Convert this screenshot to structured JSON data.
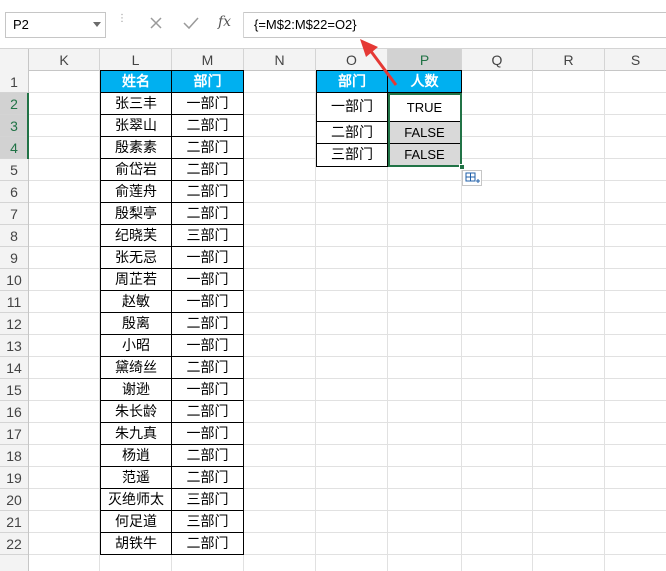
{
  "name_box": {
    "value": "P2"
  },
  "formula_bar": {
    "fx_label": "fx",
    "formula": "{=M$2:M$22=O2}"
  },
  "columns": [
    "K",
    "L",
    "M",
    "N",
    "O",
    "P",
    "Q",
    "R",
    "S"
  ],
  "rows": [
    "1",
    "2",
    "3",
    "4",
    "5",
    "6",
    "7",
    "8",
    "9",
    "10",
    "11",
    "12",
    "13",
    "14",
    "15",
    "16",
    "17",
    "18",
    "19",
    "20",
    "21",
    "22"
  ],
  "table_left": {
    "headers": [
      "姓名",
      "部门"
    ],
    "rows": [
      [
        "张三丰",
        "一部门"
      ],
      [
        "张翠山",
        "二部门"
      ],
      [
        "殷素素",
        "二部门"
      ],
      [
        "俞岱岩",
        "二部门"
      ],
      [
        "俞莲舟",
        "二部门"
      ],
      [
        "殷梨亭",
        "二部门"
      ],
      [
        "纪晓芙",
        "三部门"
      ],
      [
        "张无忌",
        "一部门"
      ],
      [
        "周芷若",
        "一部门"
      ],
      [
        "赵敏",
        "一部门"
      ],
      [
        "殷离",
        "二部门"
      ],
      [
        "小昭",
        "一部门"
      ],
      [
        "黛绮丝",
        "二部门"
      ],
      [
        "谢逊",
        "一部门"
      ],
      [
        "朱长龄",
        "二部门"
      ],
      [
        "朱九真",
        "一部门"
      ],
      [
        "杨逍",
        "二部门"
      ],
      [
        "范遥",
        "二部门"
      ],
      [
        "灭绝师太",
        "三部门"
      ],
      [
        "何足道",
        "三部门"
      ],
      [
        "胡铁牛",
        "二部门"
      ]
    ]
  },
  "table_right": {
    "headers": [
      "部门",
      "人数"
    ],
    "rows": [
      [
        "一部门",
        "TRUE"
      ],
      [
        "二部门",
        "FALSE"
      ],
      [
        "三部门",
        "FALSE"
      ]
    ]
  },
  "colors": {
    "header_fill": "#00b0f0",
    "selection": "#217346",
    "arrow": "#e53935"
  }
}
